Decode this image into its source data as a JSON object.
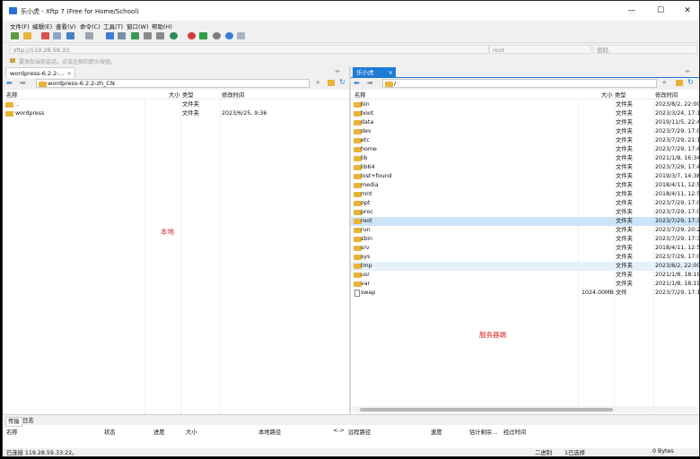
{
  "window": {
    "title": "乐小虎 - Xftp 7 (Free for Home/School)",
    "controls": [
      "—",
      "☐",
      "✕"
    ]
  },
  "menu": [
    "文件(F)",
    "编辑(E)",
    "查看(V)",
    "命令(C)",
    "工具(T)",
    "窗口(W)",
    "帮助(H)"
  ],
  "toolbar": {
    "icons": [
      "new-session-icon",
      "open-folder-icon",
      "disconnect-icon",
      "link-icon",
      "new-transfer-icon",
      "layout-icon",
      "refresh-icon",
      "sync-icon",
      "copy-icon",
      "paste-icon",
      "globe-icon",
      "xshell-icon",
      "xftp-icon",
      "settings-icon",
      "help-icon",
      "chat-icon"
    ]
  },
  "address": {
    "host": "sftp://119.28.59.33",
    "user_placeholder": "root",
    "password_placeholder": "密码"
  },
  "hint": "要添加当前会话，点击左侧的箭头按钮。",
  "local": {
    "tab": "wordpress-6.2.2-...",
    "path": "wordpress-6.2.2-zh_CN",
    "columns": {
      "name": "名称",
      "size": "大小",
      "type": "类型",
      "modified": "修改时间"
    },
    "rows": [
      {
        "name": "..",
        "size": "",
        "type": "文件夹",
        "modified": ""
      },
      {
        "name": "wordpress",
        "size": "",
        "type": "文件夹",
        "modified": "2023/6/25, 9:36"
      }
    ],
    "label": "本地"
  },
  "remote": {
    "tab": "乐小虎",
    "path": "/",
    "columns": {
      "name": "名称",
      "size": "大小",
      "type": "类型",
      "modified": "修改时间"
    },
    "rows": [
      {
        "name": "bin",
        "size": "",
        "type": "文件夹",
        "modified": "2023/8/2, 22:00",
        "state": ""
      },
      {
        "name": "boot",
        "size": "",
        "type": "文件夹",
        "modified": "2023/3/24, 17:1",
        "state": ""
      },
      {
        "name": "data",
        "size": "",
        "type": "文件夹",
        "modified": "2019/11/5, 22:4",
        "state": ""
      },
      {
        "name": "dev",
        "size": "",
        "type": "文件夹",
        "modified": "2023/7/29, 17:0",
        "state": ""
      },
      {
        "name": "etc",
        "size": "",
        "type": "文件夹",
        "modified": "2023/7/29, 21:1",
        "state": ""
      },
      {
        "name": "home",
        "size": "",
        "type": "文件夹",
        "modified": "2023/7/29, 17:4",
        "state": ""
      },
      {
        "name": "lib",
        "size": "",
        "type": "文件夹",
        "modified": "2021/1/8, 16:34",
        "state": ""
      },
      {
        "name": "lib64",
        "size": "",
        "type": "文件夹",
        "modified": "2023/7/29, 17:4",
        "state": ""
      },
      {
        "name": "lost+found",
        "size": "",
        "type": "文件夹",
        "modified": "2019/3/7, 14:38",
        "state": ""
      },
      {
        "name": "media",
        "size": "",
        "type": "文件夹",
        "modified": "2018/4/11, 12:5",
        "state": ""
      },
      {
        "name": "mnt",
        "size": "",
        "type": "文件夹",
        "modified": "2018/4/11, 12:5",
        "state": ""
      },
      {
        "name": "opt",
        "size": "",
        "type": "文件夹",
        "modified": "2023/7/29, 17:0",
        "state": ""
      },
      {
        "name": "proc",
        "size": "",
        "type": "文件夹",
        "modified": "2023/7/29, 17:0",
        "state": ""
      },
      {
        "name": "root",
        "size": "",
        "type": "文件夹",
        "modified": "2023/7/29, 17:3",
        "state": "selected"
      },
      {
        "name": "run",
        "size": "",
        "type": "文件夹",
        "modified": "2023/7/29, 20:2",
        "state": ""
      },
      {
        "name": "sbin",
        "size": "",
        "type": "文件夹",
        "modified": "2023/7/29, 17:3",
        "state": ""
      },
      {
        "name": "srv",
        "size": "",
        "type": "文件夹",
        "modified": "2018/4/11, 12:5",
        "state": ""
      },
      {
        "name": "sys",
        "size": "",
        "type": "文件夹",
        "modified": "2023/7/29, 17:0",
        "state": ""
      },
      {
        "name": "tmp",
        "size": "",
        "type": "文件夹",
        "modified": "2023/8/2, 22:00",
        "state": "hover"
      },
      {
        "name": "usr",
        "size": "",
        "type": "文件夹",
        "modified": "2021/1/8, 18:19",
        "state": ""
      },
      {
        "name": "var",
        "size": "",
        "type": "文件夹",
        "modified": "2021/1/8, 18:19",
        "state": ""
      },
      {
        "name": "swap",
        "size": "1024.00MB",
        "type": "文件",
        "modified": "2023/7/29, 17:1",
        "state": "file"
      }
    ],
    "label": "服务器端"
  },
  "transfers": {
    "tabs": [
      "传输",
      "日志"
    ],
    "columns": [
      "名称",
      "状态",
      "进度",
      "大小",
      "本地路径",
      "<->",
      "远程路径",
      "速度",
      "估计剩余...",
      "经过时间"
    ]
  },
  "status": {
    "connection": "已连接 119.28.59.33:22。",
    "mode": "二进制",
    "selected": "1已选择",
    "size": "0 Bytes"
  },
  "colors": {
    "accent": "#1e7bd6",
    "selected_row": "#cce4f7",
    "hover_row": "#e5f1fb",
    "folder": "#e8b437",
    "pane_label": "#e02020"
  }
}
